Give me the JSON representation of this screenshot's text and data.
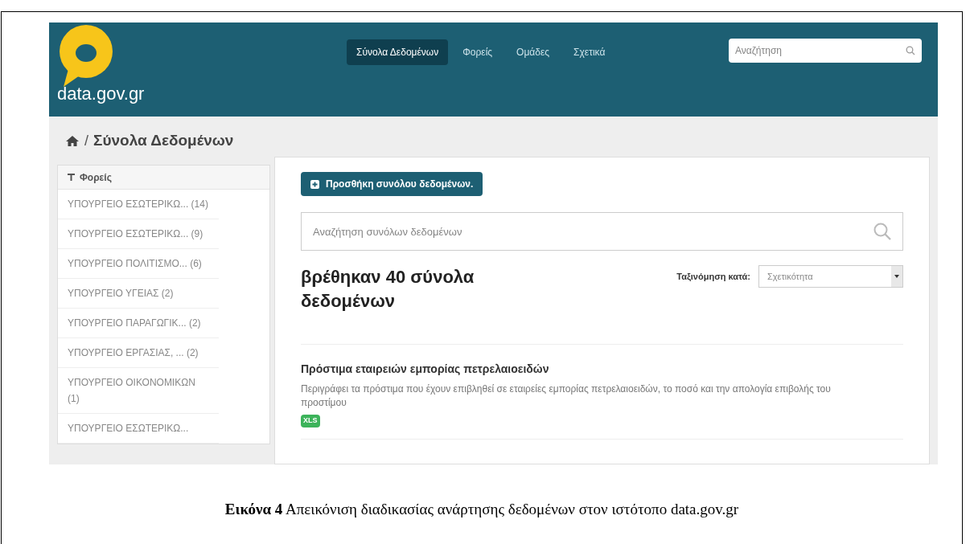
{
  "logo": {
    "text": "data.gov.gr"
  },
  "nav": [
    {
      "label": "Σύνολα Δεδομένων",
      "selected": true
    },
    {
      "label": "Φορείς",
      "selected": false
    },
    {
      "label": "Ομάδες",
      "selected": false
    },
    {
      "label": "Σχετικά",
      "selected": false
    }
  ],
  "header_search": {
    "placeholder": "Αναζήτηση"
  },
  "breadcrumb": {
    "separator": "/",
    "current": "Σύνολα Δεδομένων"
  },
  "sidebar": {
    "title": "Φορείς",
    "items": [
      {
        "label": "ΥΠΟΥΡΓΕΙΟ ΕΣΩΤΕΡΙΚΩ...",
        "count": "(14)"
      },
      {
        "label": "ΥΠΟΥΡΓΕΙΟ ΕΣΩΤΕΡΙΚΩ...",
        "count": "(9)"
      },
      {
        "label": "ΥΠΟΥΡΓΕΙΟ ΠΟΛΙΤΙΣΜΟ...",
        "count": "(6)"
      },
      {
        "label": "ΥΠΟΥΡΓΕΙΟ ΥΓΕΙΑΣ",
        "count": "(2)"
      },
      {
        "label": "ΥΠΟΥΡΓΕΙΟ ΠΑΡΑΓΩΓΙΚ...",
        "count": "(2)"
      },
      {
        "label": "ΥΠΟΥΡΓΕΙΟ ΕΡΓΑΣΙΑΣ, ...",
        "count": "(2)"
      },
      {
        "label": "ΥΠΟΥΡΓΕΙΟ ΟΙΚΟΝΟΜΙΚΩΝ",
        "count": "(1)"
      },
      {
        "label": "ΥΠΟΥΡΓΕΙΟ ΕΣΩΤΕΡΙΚΩ..."
      }
    ]
  },
  "add_button": "Προσθήκη συνόλου δεδομένων.",
  "dataset_search": {
    "placeholder": "Αναζήτηση συνόλων δεδομένων"
  },
  "results_heading": "βρέθηκαν 40 σύνολα δεδομένων",
  "sort": {
    "label": "Ταξινόμηση κατά:",
    "value": "Σχετικότητα"
  },
  "datasets": [
    {
      "title": "Πρόστιμα εταιρειών εμπορίας πετρελαιοειδών",
      "description": "Περιγράφει τα πρόστιμα που έχουν επιβληθεί σε εταιρείες εμπορίας πετρελαιοειδών, το ποσό και την απολογία επιβολής του προστίμου",
      "formats": [
        "XLS"
      ]
    }
  ],
  "caption": "**Εικόνα 4** Απεικόνιση διαδικασίας ανάρτησης δεδομένων στον ιστότοπο data.gov.gr"
}
